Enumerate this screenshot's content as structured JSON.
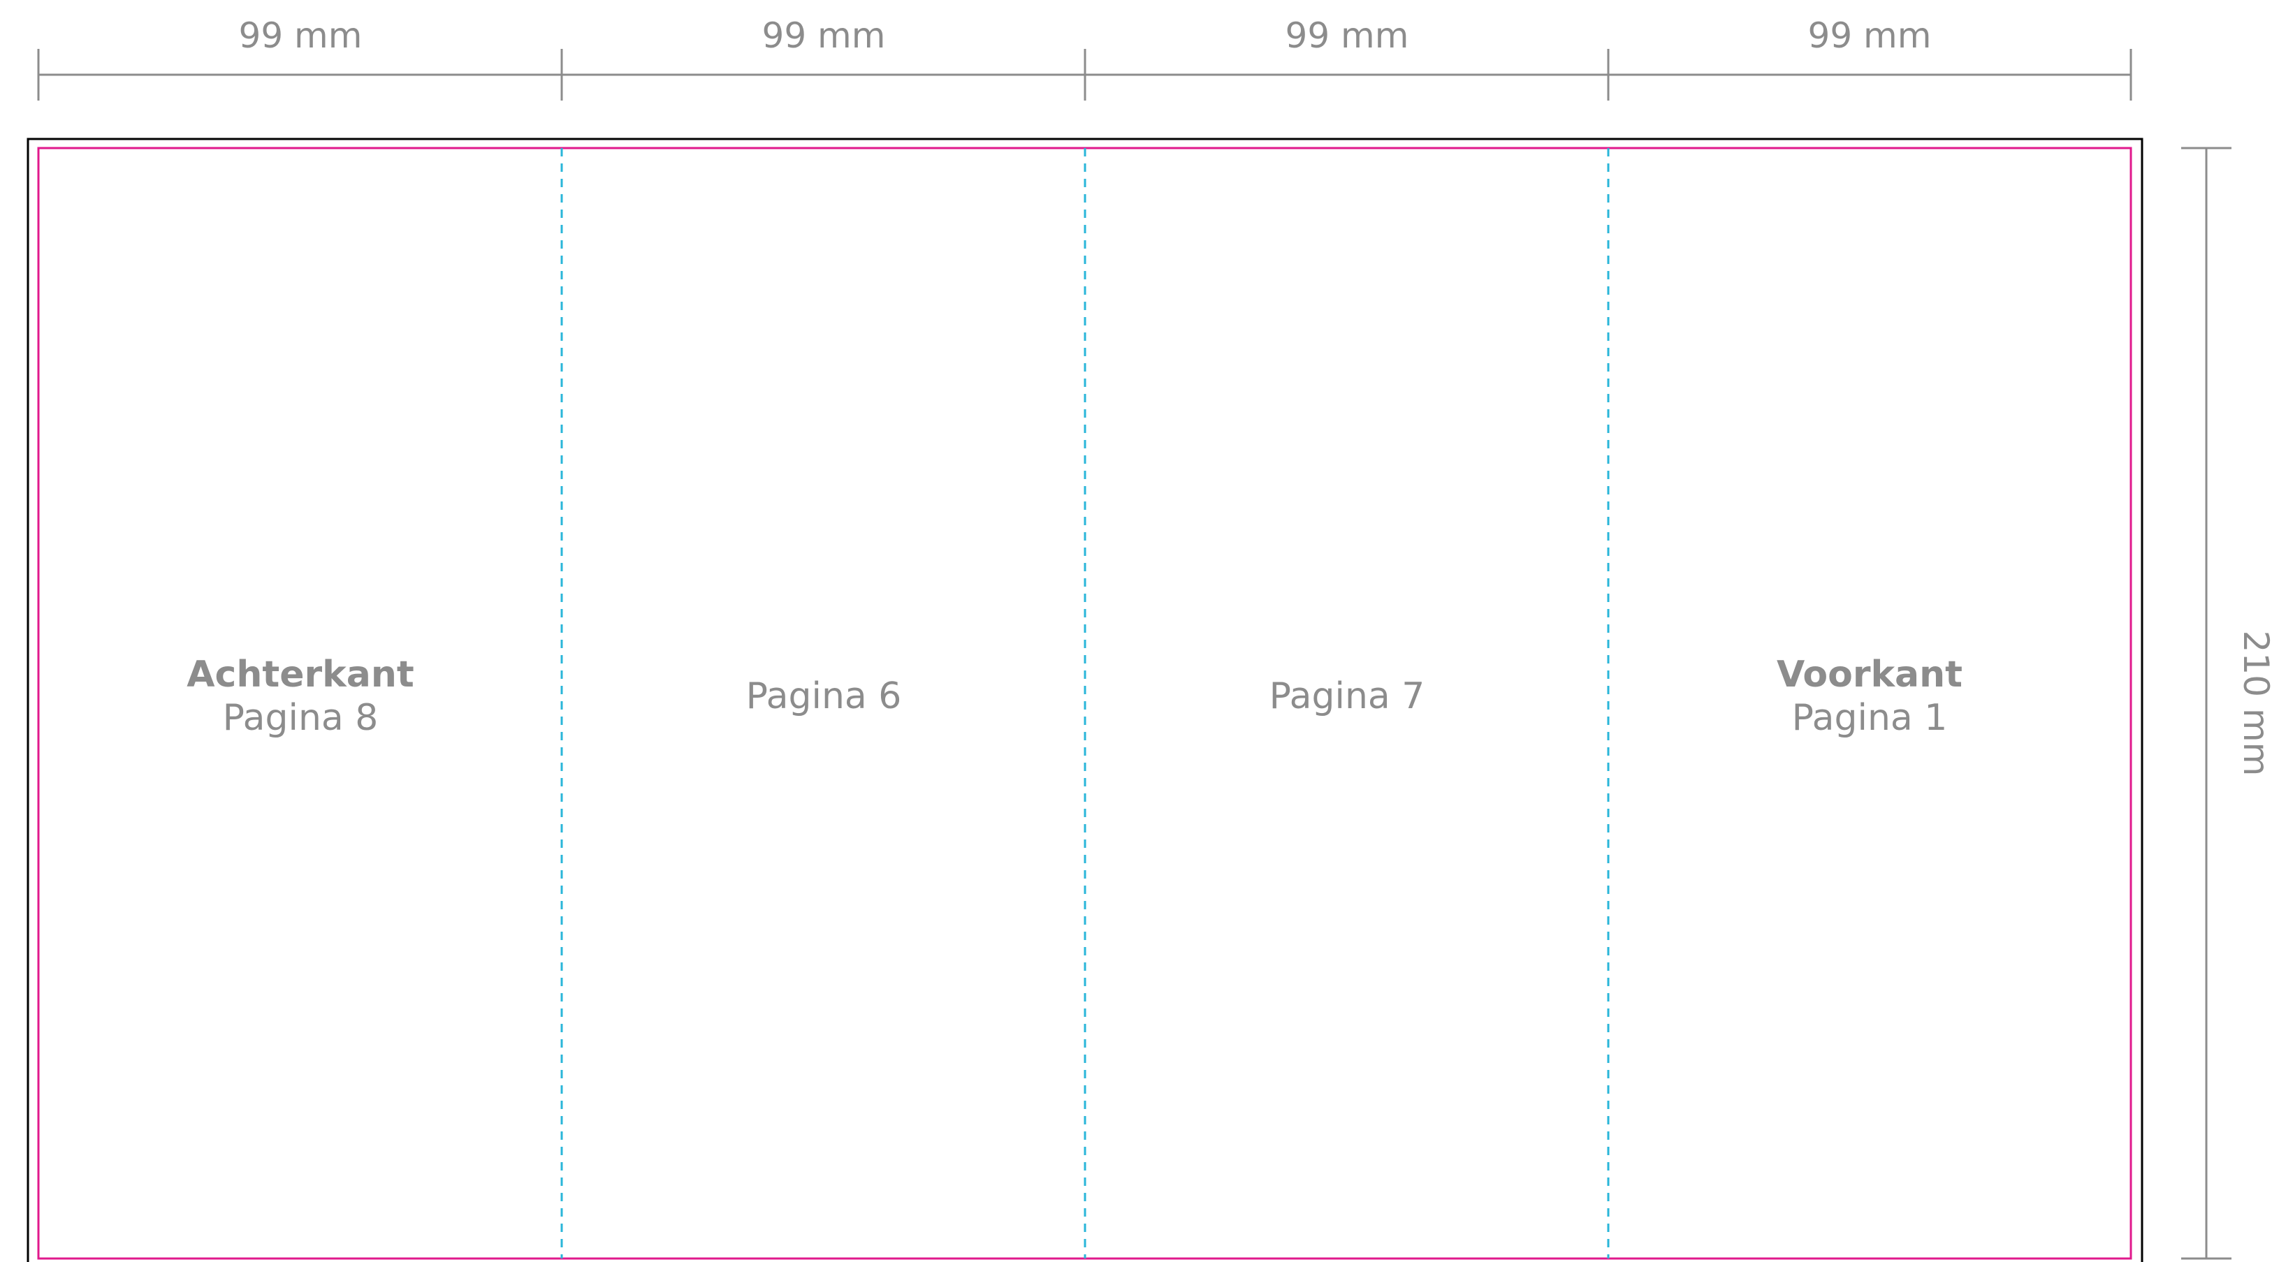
{
  "dimensions": {
    "widths": [
      "99 mm",
      "99 mm",
      "99 mm",
      "99 mm"
    ],
    "height": "210 mm"
  },
  "panels": [
    {
      "title": "Achterkant",
      "page": "Pagina 8"
    },
    {
      "title": "",
      "page": "Pagina 6"
    },
    {
      "title": "",
      "page": "Pagina 7"
    },
    {
      "title": "Voorkant",
      "page": "Pagina 1"
    }
  ],
  "colors": {
    "dimension_line": "#8c8c8c",
    "bleed_border": "#000000",
    "trim_border": "#e0198c",
    "fold_line": "#29b6d9",
    "label_text": "#8c8c8c"
  }
}
